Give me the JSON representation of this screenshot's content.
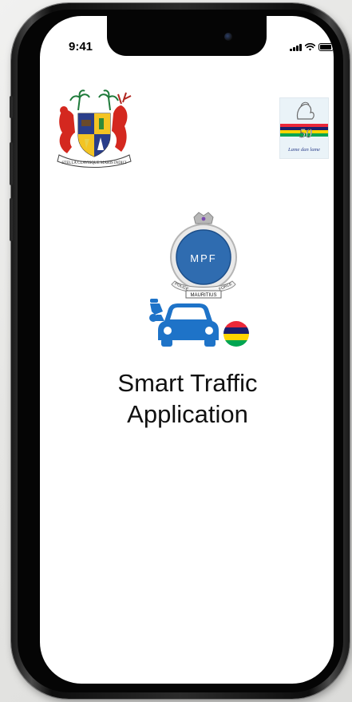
{
  "status_bar": {
    "time": "9:41",
    "signal_icon": "cellular-signal-icon",
    "wifi_icon": "wifi-icon",
    "battery_icon": "battery-icon"
  },
  "header": {
    "left_logo": "mauritius-coat-of-arms",
    "left_logo_motto": "STELLA CLAVISQUE MARIS INDICI",
    "right_logo": "mauritius-50-anniversary-logo",
    "right_logo_number": "50",
    "right_logo_caption": "Lame dan lame"
  },
  "main": {
    "crest_text": "MPF",
    "crest_banner": "MAURITIUS",
    "crest_scroll_left": "POLICE",
    "crest_scroll_right": "FORCE",
    "vehicle_icon": "car-and-motorcycle-icon",
    "flag_icon": "mauritius-flag-icon",
    "title_line1": "Smart Traffic",
    "title_line2": "Application"
  },
  "colors": {
    "vehicle_blue": "#1e73c8",
    "crest_blue": "#2f6cb0",
    "flag_red": "#ea2839",
    "flag_blue": "#1a206d",
    "flag_yellow": "#ffd500",
    "flag_green": "#00a551"
  }
}
